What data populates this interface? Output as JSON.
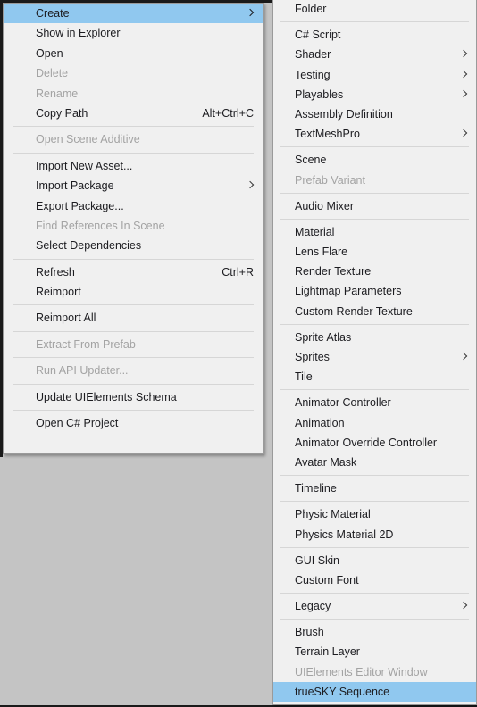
{
  "theme": {
    "menu_bg": "#f0f0f0",
    "highlight_bg": "#90c8ef",
    "text_color": "#1c1c20",
    "disabled_color": "#a3a3a3",
    "separator_color": "#dcdcdc",
    "desktop_bg": "#c4c4c4"
  },
  "context_menu": {
    "name": "Project Asset Context Menu",
    "items": [
      {
        "label": "Create",
        "type": "item",
        "submenu": true,
        "highlight": true,
        "disabled": false,
        "shortcut": ""
      },
      {
        "label": "Show in Explorer",
        "type": "item",
        "submenu": false,
        "highlight": false,
        "disabled": false,
        "shortcut": ""
      },
      {
        "label": "Open",
        "type": "item",
        "submenu": false,
        "highlight": false,
        "disabled": false,
        "shortcut": ""
      },
      {
        "label": "Delete",
        "type": "item",
        "submenu": false,
        "highlight": false,
        "disabled": true,
        "shortcut": ""
      },
      {
        "label": "Rename",
        "type": "item",
        "submenu": false,
        "highlight": false,
        "disabled": true,
        "shortcut": ""
      },
      {
        "label": "Copy Path",
        "type": "item",
        "submenu": false,
        "highlight": false,
        "disabled": false,
        "shortcut": "Alt+Ctrl+C"
      },
      {
        "type": "separator"
      },
      {
        "label": "Open Scene Additive",
        "type": "item",
        "submenu": false,
        "highlight": false,
        "disabled": true,
        "shortcut": ""
      },
      {
        "type": "separator"
      },
      {
        "label": "Import New Asset...",
        "type": "item",
        "submenu": false,
        "highlight": false,
        "disabled": false,
        "shortcut": ""
      },
      {
        "label": "Import Package",
        "type": "item",
        "submenu": true,
        "highlight": false,
        "disabled": false,
        "shortcut": ""
      },
      {
        "label": "Export Package...",
        "type": "item",
        "submenu": false,
        "highlight": false,
        "disabled": false,
        "shortcut": ""
      },
      {
        "label": "Find References In Scene",
        "type": "item",
        "submenu": false,
        "highlight": false,
        "disabled": true,
        "shortcut": ""
      },
      {
        "label": "Select Dependencies",
        "type": "item",
        "submenu": false,
        "highlight": false,
        "disabled": false,
        "shortcut": ""
      },
      {
        "type": "separator"
      },
      {
        "label": "Refresh",
        "type": "item",
        "submenu": false,
        "highlight": false,
        "disabled": false,
        "shortcut": "Ctrl+R"
      },
      {
        "label": "Reimport",
        "type": "item",
        "submenu": false,
        "highlight": false,
        "disabled": false,
        "shortcut": ""
      },
      {
        "type": "separator"
      },
      {
        "label": "Reimport All",
        "type": "item",
        "submenu": false,
        "highlight": false,
        "disabled": false,
        "shortcut": ""
      },
      {
        "type": "separator"
      },
      {
        "label": "Extract From Prefab",
        "type": "item",
        "submenu": false,
        "highlight": false,
        "disabled": true,
        "shortcut": ""
      },
      {
        "type": "separator"
      },
      {
        "label": "Run API Updater...",
        "type": "item",
        "submenu": false,
        "highlight": false,
        "disabled": true,
        "shortcut": ""
      },
      {
        "type": "separator"
      },
      {
        "label": "Update UIElements Schema",
        "type": "item",
        "submenu": false,
        "highlight": false,
        "disabled": false,
        "shortcut": ""
      },
      {
        "type": "separator"
      },
      {
        "label": "Open C# Project",
        "type": "item",
        "submenu": false,
        "highlight": false,
        "disabled": false,
        "shortcut": ""
      }
    ]
  },
  "create_submenu": {
    "name": "Create Submenu",
    "items": [
      {
        "label": "Folder",
        "type": "item",
        "submenu": false,
        "highlight": false,
        "disabled": false
      },
      {
        "type": "separator"
      },
      {
        "label": "C# Script",
        "type": "item",
        "submenu": false,
        "highlight": false,
        "disabled": false
      },
      {
        "label": "Shader",
        "type": "item",
        "submenu": true,
        "highlight": false,
        "disabled": false
      },
      {
        "label": "Testing",
        "type": "item",
        "submenu": true,
        "highlight": false,
        "disabled": false
      },
      {
        "label": "Playables",
        "type": "item",
        "submenu": true,
        "highlight": false,
        "disabled": false
      },
      {
        "label": "Assembly Definition",
        "type": "item",
        "submenu": false,
        "highlight": false,
        "disabled": false
      },
      {
        "label": "TextMeshPro",
        "type": "item",
        "submenu": true,
        "highlight": false,
        "disabled": false
      },
      {
        "type": "separator"
      },
      {
        "label": "Scene",
        "type": "item",
        "submenu": false,
        "highlight": false,
        "disabled": false
      },
      {
        "label": "Prefab Variant",
        "type": "item",
        "submenu": false,
        "highlight": false,
        "disabled": true
      },
      {
        "type": "separator"
      },
      {
        "label": "Audio Mixer",
        "type": "item",
        "submenu": false,
        "highlight": false,
        "disabled": false
      },
      {
        "type": "separator"
      },
      {
        "label": "Material",
        "type": "item",
        "submenu": false,
        "highlight": false,
        "disabled": false
      },
      {
        "label": "Lens Flare",
        "type": "item",
        "submenu": false,
        "highlight": false,
        "disabled": false
      },
      {
        "label": "Render Texture",
        "type": "item",
        "submenu": false,
        "highlight": false,
        "disabled": false
      },
      {
        "label": "Lightmap Parameters",
        "type": "item",
        "submenu": false,
        "highlight": false,
        "disabled": false
      },
      {
        "label": "Custom Render Texture",
        "type": "item",
        "submenu": false,
        "highlight": false,
        "disabled": false
      },
      {
        "type": "separator"
      },
      {
        "label": "Sprite Atlas",
        "type": "item",
        "submenu": false,
        "highlight": false,
        "disabled": false
      },
      {
        "label": "Sprites",
        "type": "item",
        "submenu": true,
        "highlight": false,
        "disabled": false
      },
      {
        "label": "Tile",
        "type": "item",
        "submenu": false,
        "highlight": false,
        "disabled": false
      },
      {
        "type": "separator"
      },
      {
        "label": "Animator Controller",
        "type": "item",
        "submenu": false,
        "highlight": false,
        "disabled": false
      },
      {
        "label": "Animation",
        "type": "item",
        "submenu": false,
        "highlight": false,
        "disabled": false
      },
      {
        "label": "Animator Override Controller",
        "type": "item",
        "submenu": false,
        "highlight": false,
        "disabled": false
      },
      {
        "label": "Avatar Mask",
        "type": "item",
        "submenu": false,
        "highlight": false,
        "disabled": false
      },
      {
        "type": "separator"
      },
      {
        "label": "Timeline",
        "type": "item",
        "submenu": false,
        "highlight": false,
        "disabled": false
      },
      {
        "type": "separator"
      },
      {
        "label": "Physic Material",
        "type": "item",
        "submenu": false,
        "highlight": false,
        "disabled": false
      },
      {
        "label": "Physics Material 2D",
        "type": "item",
        "submenu": false,
        "highlight": false,
        "disabled": false
      },
      {
        "type": "separator"
      },
      {
        "label": "GUI Skin",
        "type": "item",
        "submenu": false,
        "highlight": false,
        "disabled": false
      },
      {
        "label": "Custom Font",
        "type": "item",
        "submenu": false,
        "highlight": false,
        "disabled": false
      },
      {
        "type": "separator"
      },
      {
        "label": "Legacy",
        "type": "item",
        "submenu": true,
        "highlight": false,
        "disabled": false
      },
      {
        "type": "separator"
      },
      {
        "label": "Brush",
        "type": "item",
        "submenu": false,
        "highlight": false,
        "disabled": false
      },
      {
        "label": "Terrain Layer",
        "type": "item",
        "submenu": false,
        "highlight": false,
        "disabled": false
      },
      {
        "label": "UIElements Editor Window",
        "type": "item",
        "submenu": false,
        "highlight": false,
        "disabled": true
      },
      {
        "label": "trueSKY Sequence",
        "type": "item",
        "submenu": false,
        "highlight": true,
        "disabled": false
      }
    ]
  }
}
